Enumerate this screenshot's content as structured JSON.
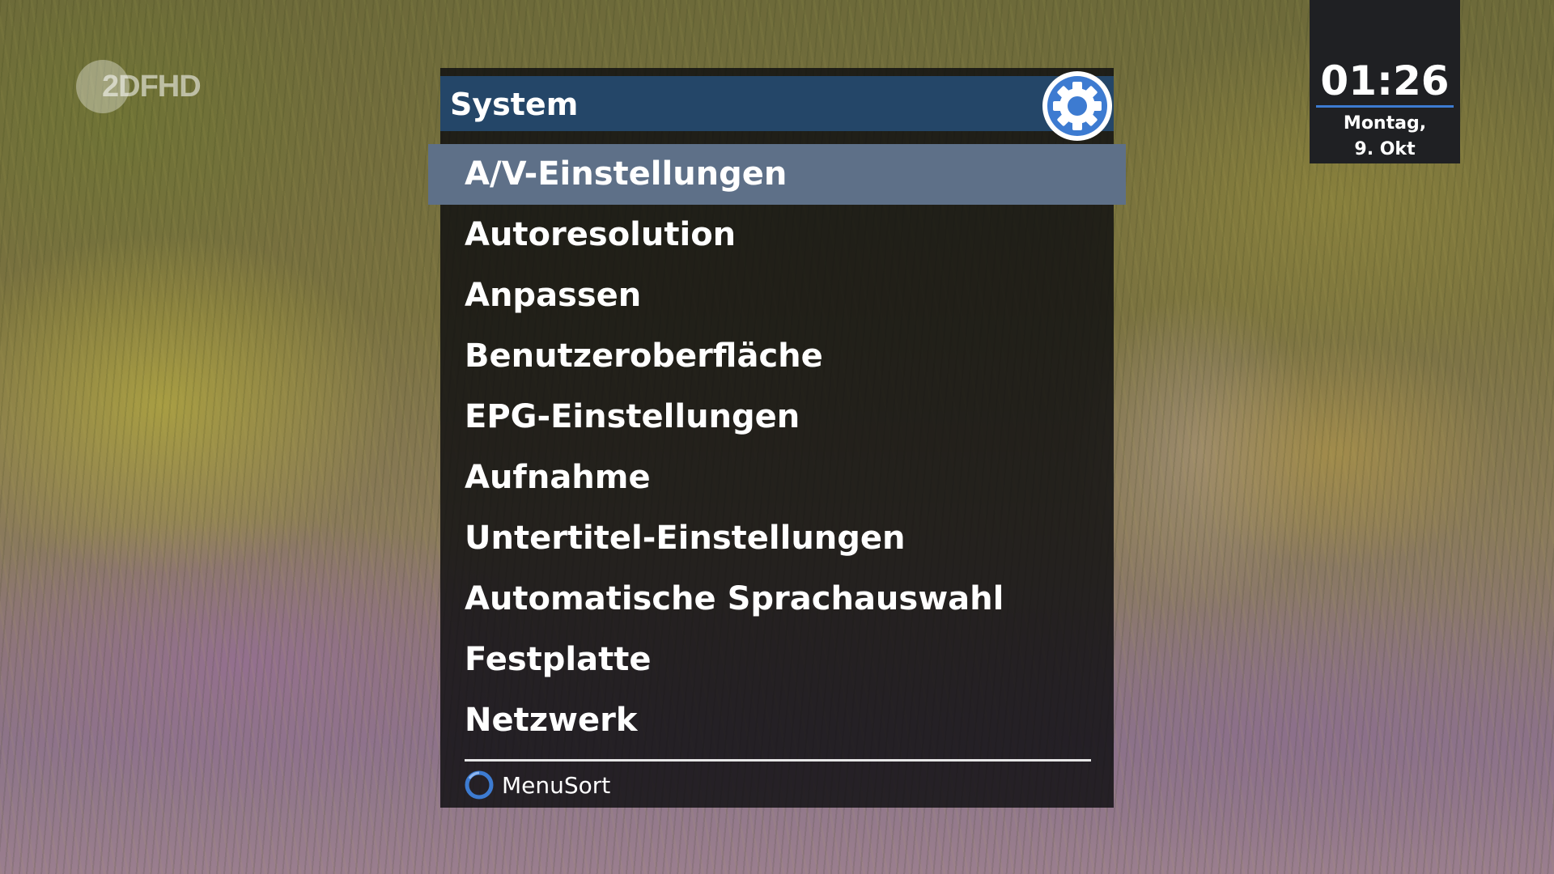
{
  "channel": {
    "logo_text": "2DFHD"
  },
  "clock": {
    "time": "01:26",
    "day": "Montag,",
    "date": "9. Okt",
    "accent": "#3d7bd1"
  },
  "menu": {
    "title": "System",
    "icon": "gear-icon",
    "items": [
      {
        "label": "A/V-Einstellungen",
        "selected": true
      },
      {
        "label": "Autoresolution",
        "selected": false
      },
      {
        "label": "Anpassen",
        "selected": false
      },
      {
        "label": "Benutzeroberfläche",
        "selected": false
      },
      {
        "label": "EPG-Einstellungen",
        "selected": false
      },
      {
        "label": "Aufnahme",
        "selected": false
      },
      {
        "label": "Untertitel-Einstellungen",
        "selected": false
      },
      {
        "label": "Automatische Sprachauswahl",
        "selected": false
      },
      {
        "label": "Festplatte",
        "selected": false
      },
      {
        "label": "Netzwerk",
        "selected": false
      }
    ],
    "footer": {
      "icon": "blue-button-icon",
      "label": "MenuSort"
    },
    "colors": {
      "header": "#244668",
      "selection": "#5e7088",
      "panel": "#0e0e10"
    }
  }
}
